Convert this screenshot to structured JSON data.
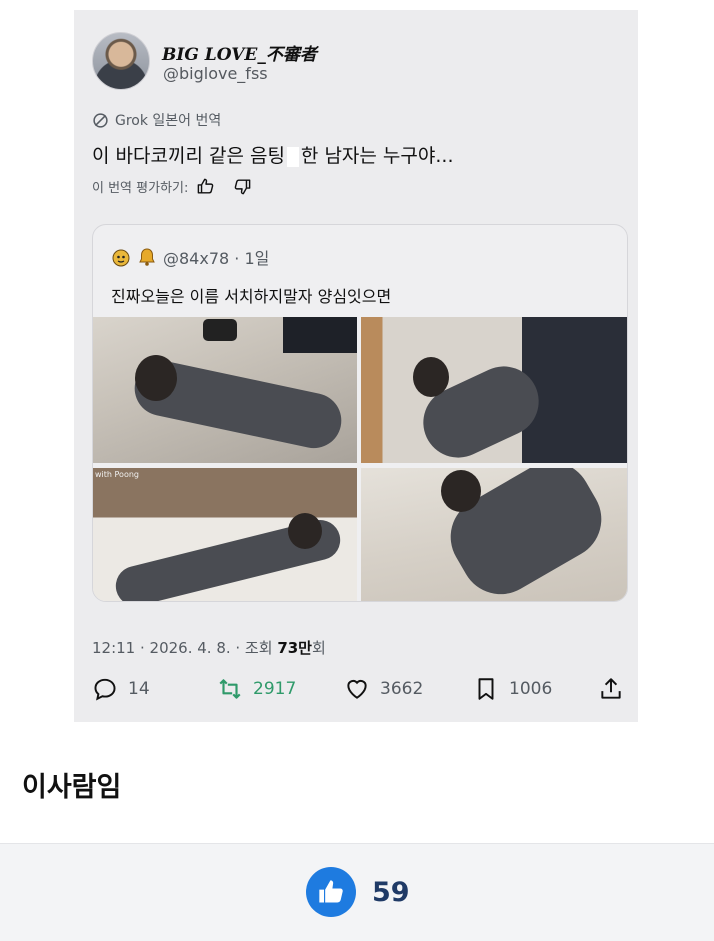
{
  "post": {
    "display_name": "BIG LOVE_不審者",
    "handle": "@biglove_fss",
    "grok_translation_label": "Grok 일본어 번역",
    "text_before": "이 바다코끼리 같은 음팅",
    "text_after": "한 남자는 누구야...",
    "rate_translation_label": "이 번역 평가하기:",
    "quote": {
      "handle_time": "@84x78 · 1일",
      "text": "진짜오늘은 이름 서치하지말자 양심잇으면",
      "photo_overlay_text": "with Poong"
    },
    "meta_time": "12:11 · 2026. 4. 8. · 조회 ",
    "meta_views": "73만",
    "meta_suffix": "회",
    "replies": "14",
    "reposts": "2917",
    "likes": "3662",
    "bookmarks": "1006"
  },
  "comment": {
    "text": "이사람임"
  },
  "footer": {
    "like_count": "59",
    "accent_color": "#1e7be0"
  },
  "icons": [
    "avatar",
    "grok-icon",
    "thumbs-up-icon",
    "thumbs-down-icon",
    "bell-icon",
    "reply-icon",
    "repost-icon",
    "heart-icon",
    "bookmark-icon",
    "share-icon",
    "like-thumb-icon"
  ]
}
